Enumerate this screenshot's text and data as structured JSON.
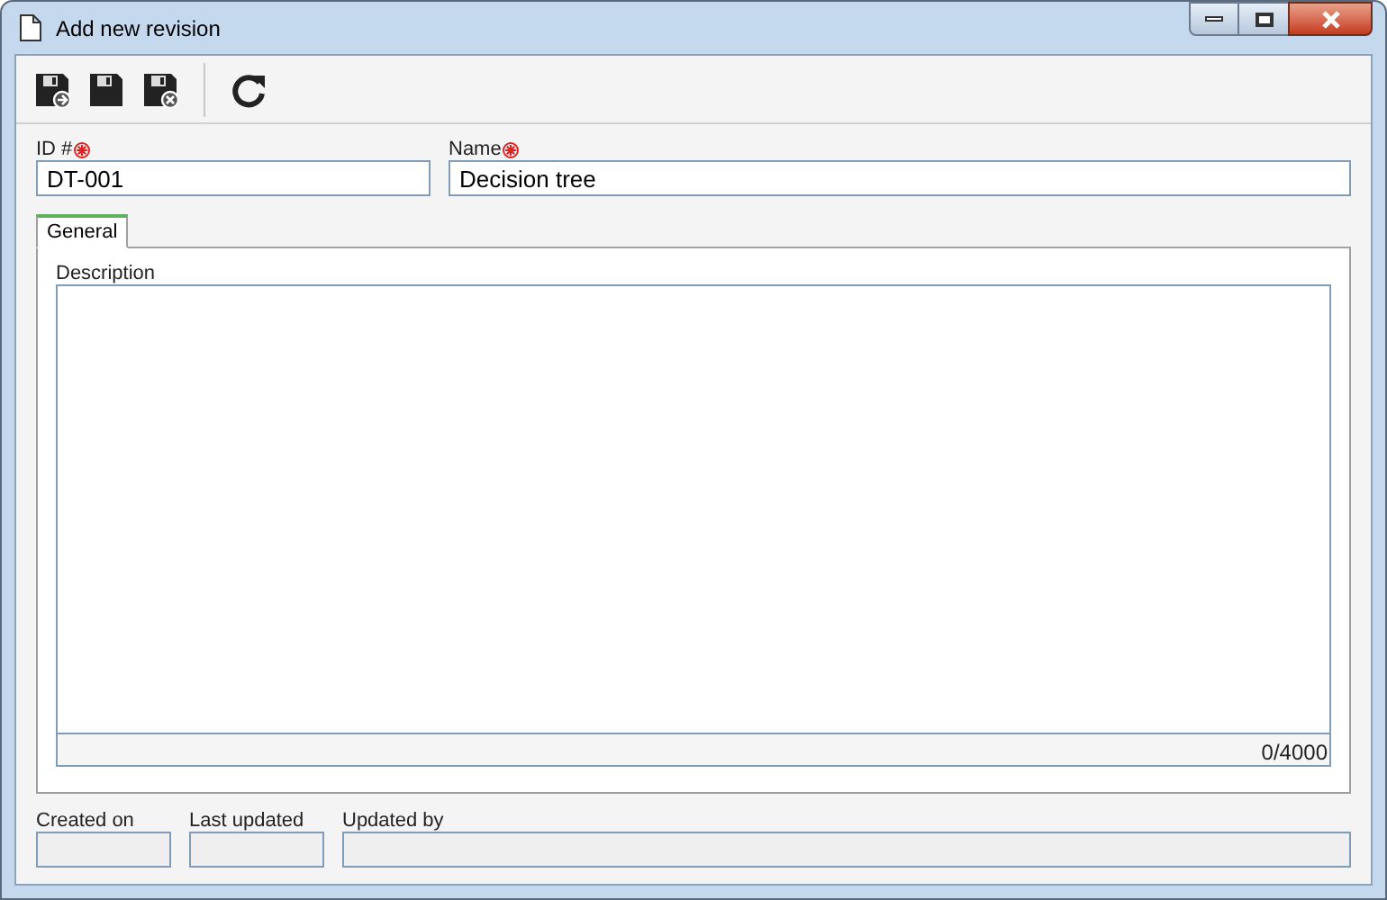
{
  "window": {
    "title": "Add new revision"
  },
  "toolbar": [
    {
      "kind": "save_new"
    },
    {
      "kind": "save"
    },
    {
      "kind": "save_close"
    },
    {
      "kind": "refresh"
    }
  ],
  "fields": [
    {
      "label": "ID #",
      "required": true,
      "value": "DT-001"
    },
    {
      "label": "Name",
      "required": true,
      "value": "Decision tree"
    }
  ],
  "tabs": [
    {
      "label": "General",
      "selected": true
    }
  ],
  "description": {
    "label": "Description",
    "counter": "0/4000"
  },
  "footer_fields": [
    {
      "label": "Created on"
    },
    {
      "label": "Last updated"
    },
    {
      "label": "Updated by"
    }
  ]
}
